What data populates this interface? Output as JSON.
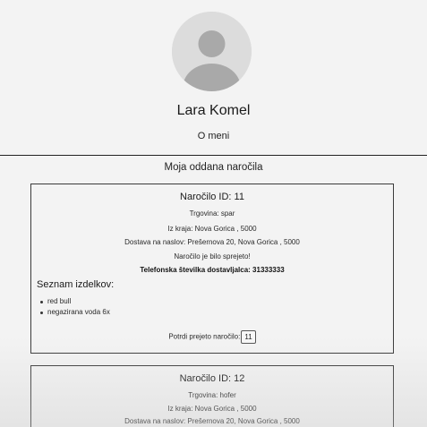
{
  "profile": {
    "avatar_icon": "user-avatar-icon",
    "name": "Lara Komel",
    "about_link": "O meni"
  },
  "orders_section": {
    "title": "Moja oddana naročila"
  },
  "orders": [
    {
      "id_label": "Naročilo ID: 11",
      "store": "Trgovina: spar",
      "from": "Iz kraja: Nova Gorica , 5000",
      "address": "Dostava na naslov: Prešernova 20, Nova Gorica , 5000",
      "status": "Naročilo je bilo sprejeto!",
      "courier_phone": "Telefonska številka dostavljalca: 31333333",
      "items_title": "Seznam izdelkov:",
      "items": [
        "red bull",
        "negazirana voda 6x"
      ],
      "confirm_label": "Potrdi prejeto naročilo:",
      "confirm_button": "11"
    },
    {
      "id_label": "Naročilo ID: 12",
      "store": "Trgovina: hofer",
      "from": "Iz kraja: Nova Gorica , 5000",
      "address": "Dostava na naslov: Prešernova 20, Nova Gorica , 5000"
    }
  ]
}
